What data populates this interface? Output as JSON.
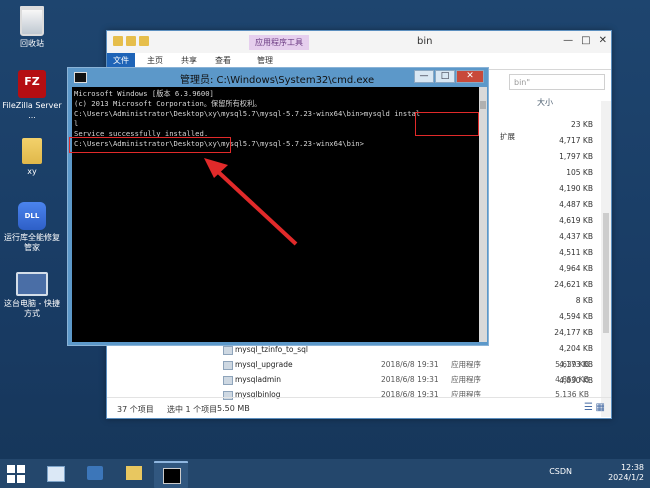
{
  "desktop": {
    "icons": [
      {
        "label": "回收站"
      },
      {
        "label": "FileZilla Server ..."
      },
      {
        "label": "xy"
      },
      {
        "label": "运行库全能修复管家"
      },
      {
        "label": "这台电脑 - 快捷方式"
      }
    ],
    "dll_badge": "DLL修复"
  },
  "explorer": {
    "title": "bin",
    "context_tab": "应用程序工具",
    "ribbon_tabs": [
      "文件",
      "主页",
      "共享",
      "查看",
      "管理"
    ],
    "search_placeholder": "bin\"",
    "column_size": "大小",
    "ext_text": "扩展",
    "sizes": [
      "23 KB",
      "4,717 KB",
      "1,797 KB",
      "105 KB",
      "4,190 KB",
      "4,487 KB",
      "4,619 KB",
      "4,437 KB",
      "4,511 KB",
      "4,964 KB",
      "24,621 KB",
      "8 KB",
      "4,594 KB",
      "24,177 KB",
      "4,204 KB",
      "4,173 KB",
      "4,830 KB"
    ],
    "rows": [
      {
        "name": "mysql_tzinfo_to_sql",
        "date": "",
        "type": "",
        "size": ""
      },
      {
        "name": "mysql_upgrade",
        "date": "2018/6/8 19:31",
        "type": "应用程序",
        "size": "5,639 KB"
      },
      {
        "name": "mysqladmin",
        "date": "2018/6/8 19:31",
        "type": "应用程序",
        "size": "4,850 KB"
      },
      {
        "name": "mysqlbinlog",
        "date": "2018/6/8 19:31",
        "type": "应用程序",
        "size": "5,136 KB"
      }
    ],
    "status": {
      "count": "37 个项目",
      "selected": "选中 1 个项目",
      "size": "5.50 MB"
    }
  },
  "cmd": {
    "title": "管理员: C:\\Windows\\System32\\cmd.exe",
    "lines": [
      "Microsoft Windows [版本 6.3.9600]",
      "(c) 2013 Microsoft Corporation。保留所有权利。",
      "",
      "C:\\Users\\Administrator\\Desktop\\xy\\mysql5.7\\mysql-5.7.23-winx64\\bin>mysqld instal",
      "l",
      "Service successfully installed.",
      "",
      "C:\\Users\\Administrator\\Desktop\\xy\\mysql5.7\\mysql-5.7.23-winx64\\bin>"
    ]
  },
  "taskbar": {
    "time": "12:38",
    "date": "2024/1/2",
    "tray": "CSDN"
  }
}
